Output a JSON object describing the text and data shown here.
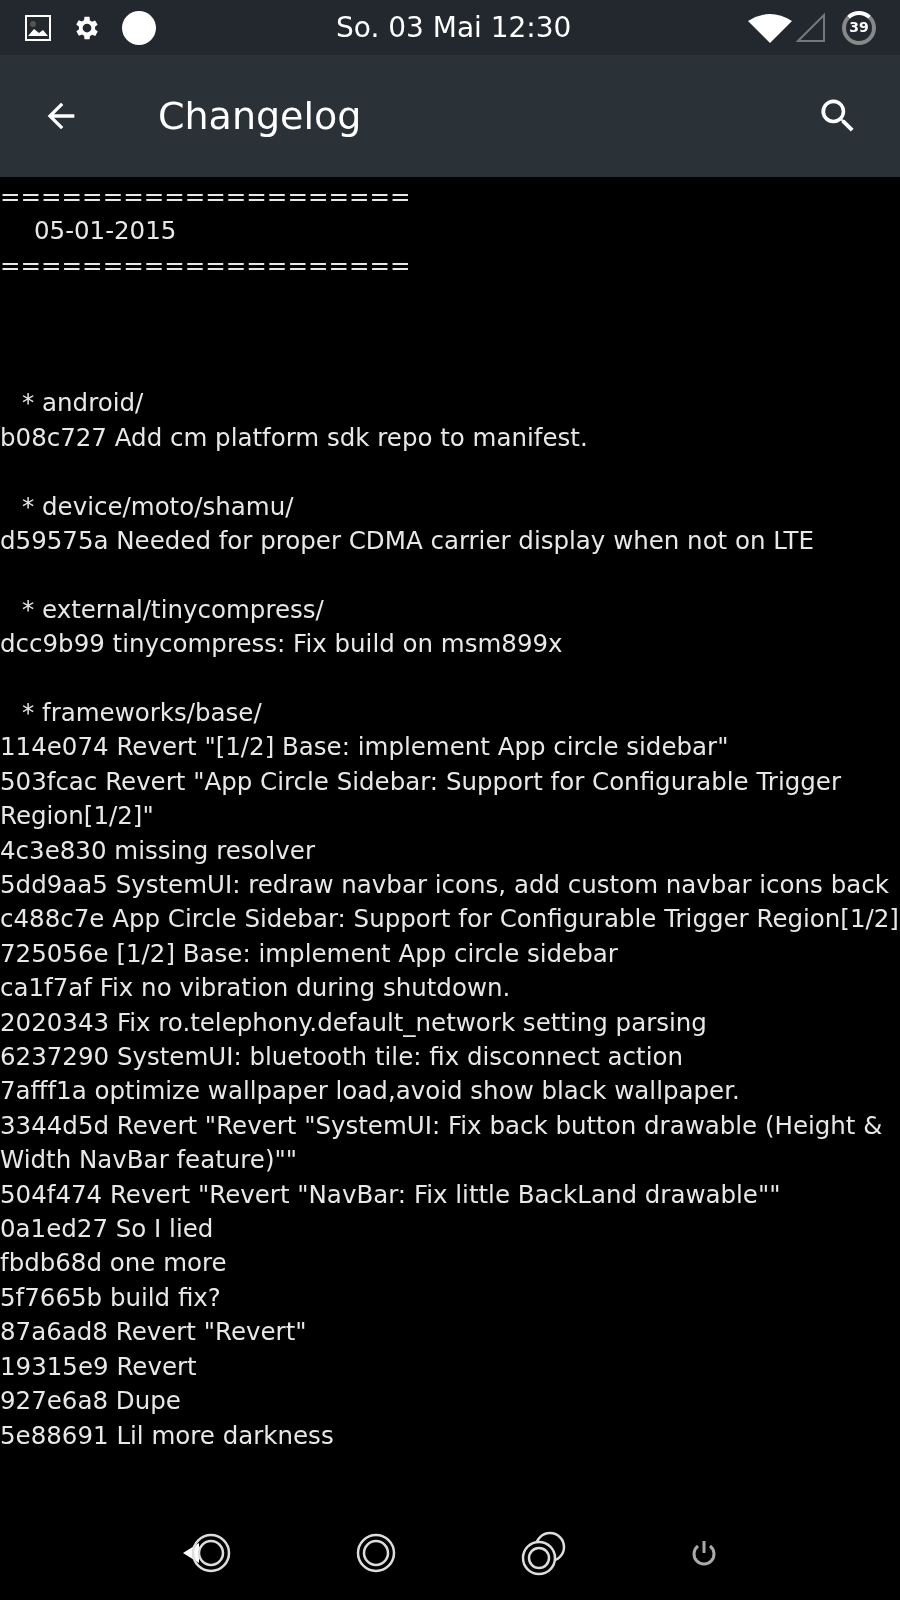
{
  "status_bar": {
    "time": "So. 03 Mai 12:30",
    "battery": "39"
  },
  "app_bar": {
    "title": "Changelog"
  },
  "changelog": {
    "rule_top": "====================",
    "date": "05-01-2015",
    "rule_bottom": "====================",
    "sections": [
      {
        "path": "* android/",
        "commits": [
          "b08c727 Add cm platform sdk repo to manifest."
        ]
      },
      {
        "path": "* device/moto/shamu/",
        "commits": [
          "d59575a Needed for proper CDMA carrier display when not on LTE"
        ]
      },
      {
        "path": "* external/tinycompress/",
        "commits": [
          "dcc9b99 tinycompress: Fix build on msm899x"
        ]
      },
      {
        "path": "* frameworks/base/",
        "commits": [
          "114e074 Revert \"[1/2] Base: implement App circle sidebar\"",
          "503fcac Revert \"App Circle Sidebar: Support for Configurable Trigger Region[1/2]\"",
          "4c3e830 missing resolver",
          "5dd9aa5 SystemUI: redraw navbar icons, add custom navbar icons back",
          "c488c7e App Circle Sidebar: Support for Configurable Trigger Region[1/2]",
          "725056e [1/2] Base: implement App circle sidebar",
          "ca1f7af Fix no vibration during shutdown.",
          "2020343 Fix ro.telephony.default_network setting parsing",
          "6237290 SystemUI: bluetooth tile: fix disconnect action",
          "7afff1a optimize wallpaper load,avoid show black wallpaper.",
          "3344d5d Revert \"Revert \"SystemUI: Fix back button drawable (Height & Width NavBar feature)\"\"",
          "504f474 Revert \"Revert \"NavBar: Fix little BackLand drawable\"\"",
          "0a1ed27 So I lied",
          "fbdb68d one more",
          "5f7665b build fix?",
          "87a6ad8 Revert \"Revert\"",
          "19315e9 Revert",
          "927e6a8 Dupe",
          "5e88691 Lil more darkness"
        ]
      }
    ]
  }
}
